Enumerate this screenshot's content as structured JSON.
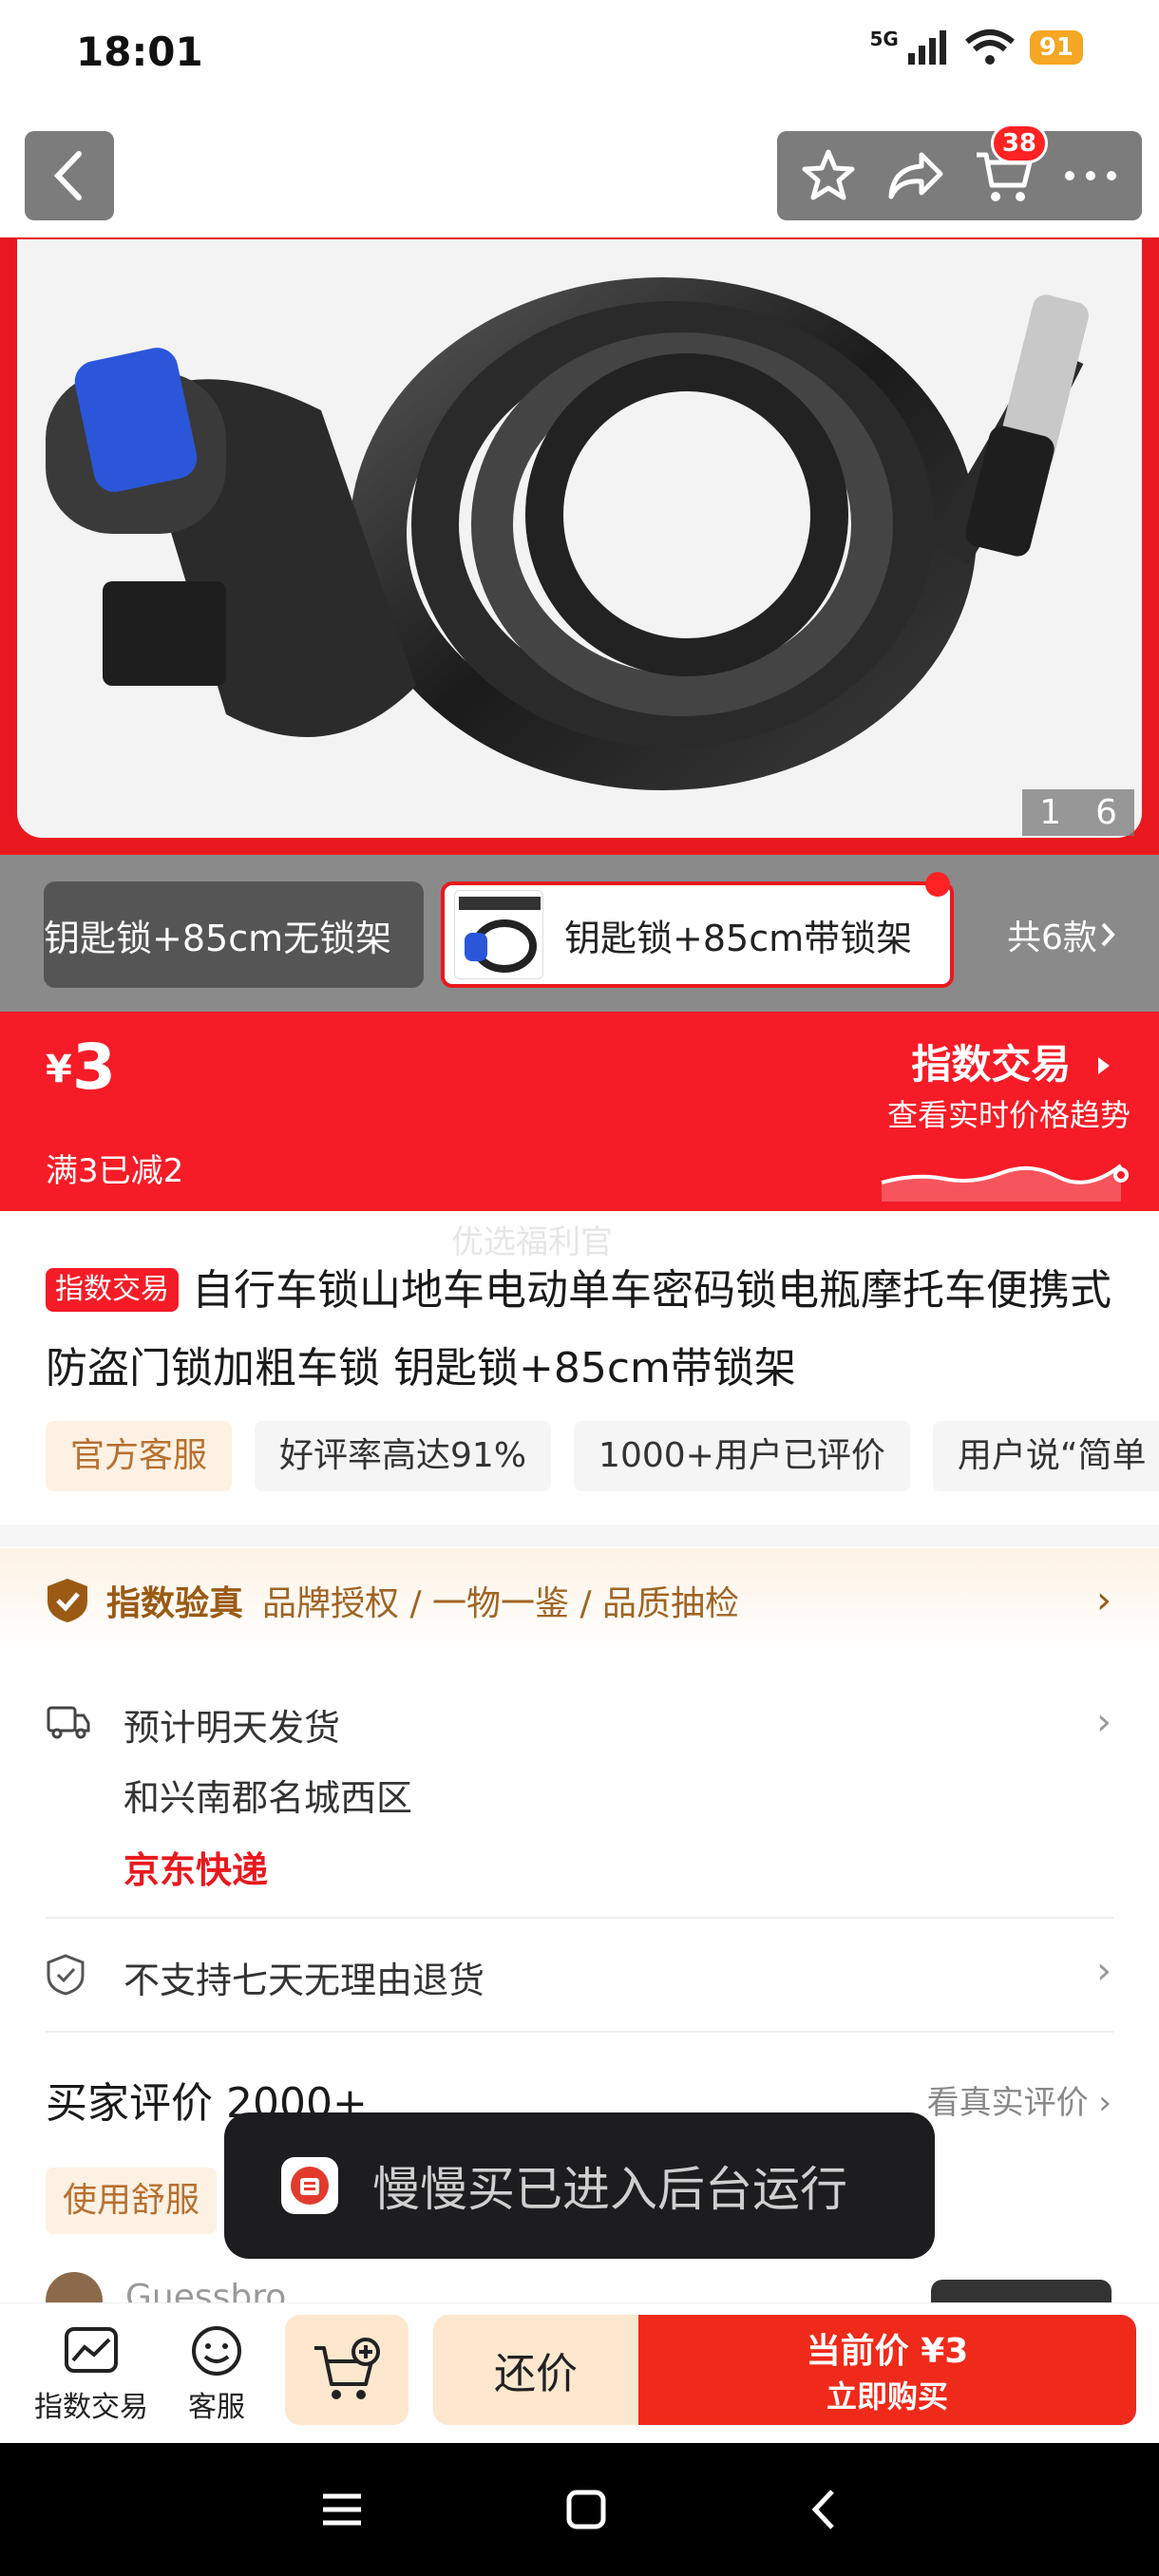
{
  "status_bar": {
    "time": "18:01",
    "network": "5G",
    "battery": "91"
  },
  "header": {
    "cart_count": "38"
  },
  "gallery": {
    "current": "1",
    "total": "6"
  },
  "variants": {
    "items": [
      "钥匙锁+85cm无锁架",
      "钥匙锁+85cm带锁架"
    ],
    "more": "共6款"
  },
  "price": {
    "currency": "¥",
    "value": "3",
    "promo": "满3已减2",
    "index_title": "指数交易",
    "index_sub": "查看实时价格趋势"
  },
  "product": {
    "tag": "指数交易",
    "title": "自行车锁山地车电动单车密码锁电瓶摩托车便携式防盗门锁加粗车锁 钥匙锁+85cm带锁架",
    "watermark": "优选福利官",
    "chips": [
      "官方客服",
      "好评率高达91%",
      "1000+用户已评价",
      "用户说“简单"
    ]
  },
  "verify": {
    "title": "指数验真",
    "desc": "品牌授权 / 一物一鉴 / 品质抽检"
  },
  "shipping": {
    "line1": "预计明天发货",
    "line2": "和兴南郡名城西区",
    "carrier": "京东快递"
  },
  "returns": {
    "text": "不支持七天无理由退货"
  },
  "reviews": {
    "title": "买家评价 2000+",
    "link": "看真实评价",
    "chip": "使用舒服",
    "first_user": "Guessbro"
  },
  "toast": {
    "text": "慢慢买已进入后台运行"
  },
  "bottom_bar": {
    "index_label": "指数交易",
    "service_label": "客服",
    "bargain_label": "还价",
    "buy_price": "当前价 ¥3",
    "buy_label": "立即购买"
  },
  "colors": {
    "brand_red": "#f51c27",
    "accent_gold": "#9a5a14"
  }
}
